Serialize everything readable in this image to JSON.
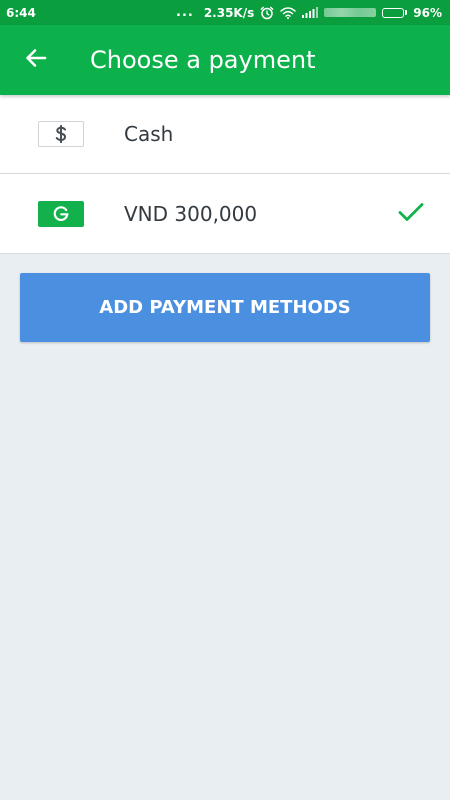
{
  "status_bar": {
    "time": "6:44",
    "dots": "...",
    "speed": "2.35K/s",
    "battery": "96%",
    "battery_level": 0.96,
    "icons": [
      "alarm-icon",
      "wifi-icon",
      "signal-icon",
      "battery-icon"
    ]
  },
  "header": {
    "title": "Choose a payment",
    "back_icon": "arrow-left-icon"
  },
  "payment_methods": [
    {
      "label": "Cash",
      "icon": "dollar-icon",
      "selected": false
    },
    {
      "label": "VND 300,000",
      "icon": "grab-g-icon",
      "selected": true
    }
  ],
  "actions": {
    "add_label": "ADD PAYMENT METHODS"
  },
  "colors": {
    "status_bar": "#0a9e3f",
    "app_bar": "#0db14b",
    "accent_green": "#12b14c",
    "button_blue": "#4a8fe0",
    "background": "#e9eef2"
  }
}
